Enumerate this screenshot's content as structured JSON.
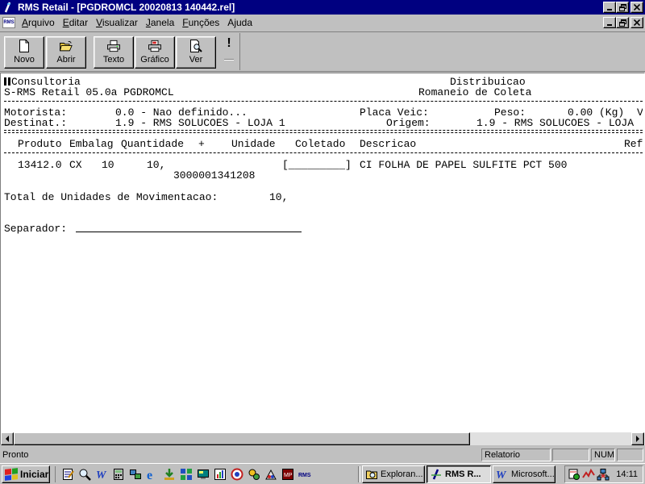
{
  "window": {
    "title": "RMS Retail - [PGDROMCL 20020813 140442.rel]",
    "app_icon": "rms-app-icon"
  },
  "menu": {
    "items": [
      {
        "label": "Arquivo",
        "accel": "A"
      },
      {
        "label": "Editar",
        "accel": "E"
      },
      {
        "label": "Visualizar",
        "accel": "V"
      },
      {
        "label": "Janela",
        "accel": "J"
      },
      {
        "label": "Funções",
        "accel": "F"
      },
      {
        "label": "Ajuda",
        "accel": "j"
      }
    ]
  },
  "toolbar": {
    "buttons": [
      {
        "label": "Novo",
        "icon": "new-document-icon"
      },
      {
        "label": "Abrir",
        "icon": "open-folder-icon"
      },
      {
        "label": "Texto",
        "icon": "print-text-icon"
      },
      {
        "label": "Gráfico",
        "icon": "print-graphic-icon"
      },
      {
        "label": "Ver",
        "icon": "preview-icon"
      }
    ],
    "exclaim": "!"
  },
  "report": {
    "company": "Consultoria",
    "department": "Distribuicao",
    "system": "S-RMS Retail 05.0a PGDROMCL",
    "doc_title": "Romaneio de Coleta",
    "motorista_label": "Motorista:",
    "motorista_value": "0.0 - Nao definido...",
    "placa_label": "Placa Veic:",
    "peso_label": "Peso:",
    "peso_value": "0.00 (Kg)",
    "trail_v": "V",
    "destinat_label": "Destinat.:",
    "destinat_value": "1.9 - RMS SOLUCOES - LOJA 1",
    "origem_label": "Origem:",
    "origem_value": "1.9 - RMS SOLUCOES - LOJA",
    "columns": [
      "Produto",
      "Embalag",
      "Quantidade",
      "+",
      "Unidade",
      "Coletado",
      "Descricao",
      "Ref"
    ],
    "item": {
      "produto": "13412.0",
      "embalag": "CX",
      "emb_qtd": "10",
      "quantidade": "10,",
      "coletado": "[_________]",
      "descricao": "CI FOLHA DE PAPEL SULFITE PCT 500",
      "ean": "3000001341208"
    },
    "total_label": "Total de Unidades de Movimentacao:",
    "total_value": "10,",
    "separador_label": "Separador:"
  },
  "status": {
    "text": "Pronto",
    "pane_report": "Relatorio",
    "pane_num": "NUM"
  },
  "taskbar": {
    "start_label": "Iniciar",
    "tasks": [
      {
        "label": "Exploran...",
        "icon": "explorer-icon",
        "active": false
      },
      {
        "label": "RMS R...",
        "icon": "rms-app-icon",
        "active": true
      },
      {
        "label": "Microsoft...",
        "icon": "word-icon",
        "active": false
      }
    ],
    "clock": "14:11"
  },
  "colors": {
    "titlebar": "#000080",
    "face": "#c0c0c0",
    "paper": "#ffffff"
  }
}
